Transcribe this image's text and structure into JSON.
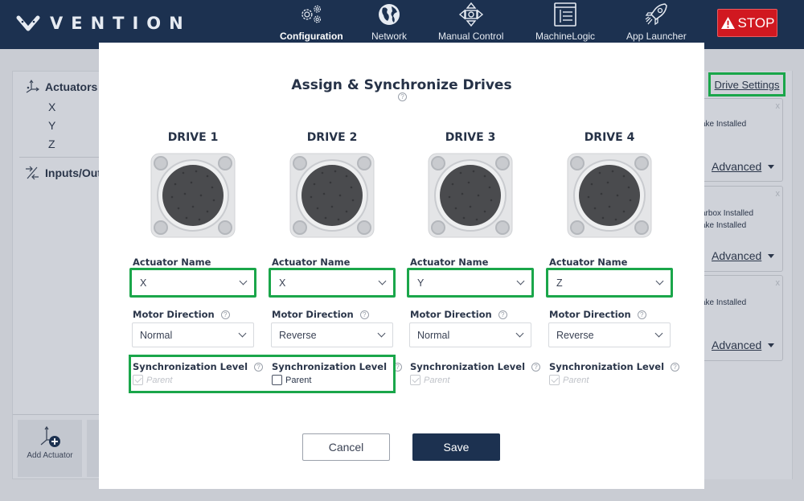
{
  "app": {
    "brand": "VENTION",
    "nav": [
      {
        "label": "Configuration",
        "icon": "gears-icon",
        "active": true
      },
      {
        "label": "Network",
        "icon": "globe-icon",
        "active": false
      },
      {
        "label": "Manual Control",
        "icon": "directional-pad-icon",
        "active": false
      },
      {
        "label": "MachineLogic",
        "icon": "machinelogic-icon",
        "active": false
      },
      {
        "label": "App Launcher",
        "icon": "rocket-icon",
        "active": false
      }
    ],
    "stop_label": "STOP",
    "colors": {
      "topbar": "#1c3150",
      "stop": "#d11820",
      "highlight": "#1aa64a",
      "primary": "#1c3150"
    }
  },
  "left_panel": {
    "actuators_heading": "Actuators",
    "actuators": [
      "X",
      "Y",
      "Z"
    ],
    "io_heading": "Inputs/Out",
    "add_actuator_label": "Add Actuator"
  },
  "right_panel": {
    "drive_settings_label": "Drive Settings",
    "cards": [
      {
        "close": "x",
        "lines": [
          "ake Installed"
        ],
        "advanced_label": "Advanced"
      },
      {
        "close": "x",
        "lines": [
          "arbox Installed",
          "ake Installed"
        ],
        "advanced_label": "Advanced"
      },
      {
        "close": "x",
        "lines": [
          "ake Installed"
        ],
        "advanced_label": "Advanced"
      }
    ]
  },
  "modal": {
    "title": "Assign & Synchronize Drives",
    "help_glyph": "?",
    "actuator_name_label": "Actuator Name",
    "motor_direction_label": "Motor Direction",
    "sync_level_label": "Synchronization Level",
    "drives": [
      {
        "title": "DRIVE 1",
        "actuator": "X",
        "motor_direction": "Normal",
        "sync_option": "Parent",
        "sync_checked": true,
        "sync_disabled": true
      },
      {
        "title": "DRIVE 2",
        "actuator": "X",
        "motor_direction": "Reverse",
        "sync_option": "Parent",
        "sync_checked": false,
        "sync_disabled": false
      },
      {
        "title": "DRIVE 3",
        "actuator": "Y",
        "motor_direction": "Normal",
        "sync_option": "Parent",
        "sync_checked": true,
        "sync_disabled": true
      },
      {
        "title": "DRIVE 4",
        "actuator": "Z",
        "motor_direction": "Reverse",
        "sync_option": "Parent",
        "sync_checked": true,
        "sync_disabled": true
      }
    ],
    "cancel_label": "Cancel",
    "save_label": "Save"
  }
}
